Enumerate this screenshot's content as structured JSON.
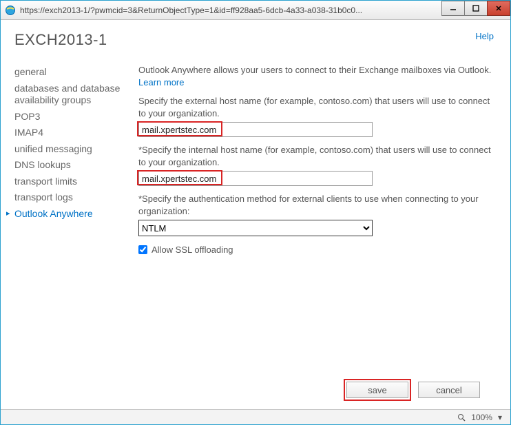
{
  "window": {
    "url": "https://exch2013-1/?pwmcid=3&ReturnObjectType=1&id=ff928aa5-6dcb-4a33-a038-31b0c0..."
  },
  "header": {
    "help": "Help",
    "title": "EXCH2013-1"
  },
  "nav": {
    "items": [
      {
        "label": "general",
        "active": false
      },
      {
        "label": "databases and database availability groups",
        "active": false
      },
      {
        "label": "POP3",
        "active": false
      },
      {
        "label": "IMAP4",
        "active": false
      },
      {
        "label": "unified messaging",
        "active": false
      },
      {
        "label": "DNS lookups",
        "active": false
      },
      {
        "label": "transport limits",
        "active": false
      },
      {
        "label": "transport logs",
        "active": false
      },
      {
        "label": "Outlook Anywhere",
        "active": true
      }
    ]
  },
  "content": {
    "intro": "Outlook Anywhere allows your users to connect to their Exchange mailboxes via Outlook. ",
    "learn_more": "Learn more",
    "external_label": "Specify the external host name (for example, contoso.com) that users will use to connect to your organization.",
    "external_value": "mail.xpertstec.com",
    "internal_label": "*Specify the internal host name (for example, contoso.com) that users will use to connect to your organization.",
    "internal_value": "mail.xpertstec.com",
    "auth_label": "*Specify the authentication method for external clients to use when connecting to your organization:",
    "auth_value": "NTLM",
    "ssl_label": "Allow SSL offloading",
    "ssl_checked": true
  },
  "footer": {
    "save": "save",
    "cancel": "cancel"
  },
  "status": {
    "zoom": "100%"
  }
}
